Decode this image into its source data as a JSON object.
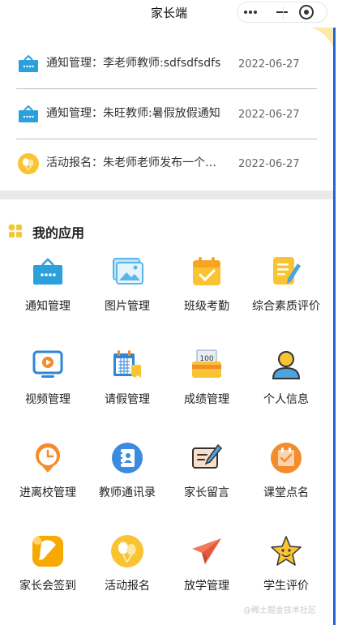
{
  "navbar": {
    "title": "家长端",
    "more_icon": "more-dots-icon",
    "minimize_icon": "minimize-icon",
    "close_icon": "target-close-icon"
  },
  "notices": [
    {
      "icon": "notice-bag-icon",
      "text": "通知管理：李老师教师:sdfsdfsdfs",
      "date": "2022-06-27"
    },
    {
      "icon": "notice-bag-icon",
      "text": "通知管理：朱旺教师:暑假放假通知",
      "date": "2022-06-27"
    },
    {
      "icon": "balloon-icon",
      "text": "活动报名：朱老师老师发布一个活动",
      "date": "2022-06-27"
    }
  ],
  "apps_section": {
    "title": "我的应用",
    "icon": "apps-grid-icon",
    "items": [
      {
        "label": "通知管理",
        "icon": "notice-bag-icon"
      },
      {
        "label": "图片管理",
        "icon": "picture-icon"
      },
      {
        "label": "班级考勤",
        "icon": "calendar-check-icon"
      },
      {
        "label": "综合素质评价",
        "icon": "note-pencil-icon"
      },
      {
        "label": "视频管理",
        "icon": "video-play-icon"
      },
      {
        "label": "请假管理",
        "icon": "leave-calendar-icon"
      },
      {
        "label": "成绩管理",
        "icon": "score-card-icon"
      },
      {
        "label": "个人信息",
        "icon": "person-icon"
      },
      {
        "label": "进离校管理",
        "icon": "clock-pin-icon"
      },
      {
        "label": "教师通讯录",
        "icon": "contact-book-icon"
      },
      {
        "label": "家长留言",
        "icon": "message-pen-icon"
      },
      {
        "label": "课堂点名",
        "icon": "rollcall-icon"
      },
      {
        "label": "家长会签到",
        "icon": "signin-pen-icon"
      },
      {
        "label": "活动报名",
        "icon": "balloon-icon"
      },
      {
        "label": "放学管理",
        "icon": "paper-plane-icon"
      },
      {
        "label": "学生评价",
        "icon": "star-face-icon"
      }
    ]
  },
  "watermark": "@稀土掘金技术社区",
  "colors": {
    "primary_blue": "#2aa1dd",
    "accent_yellow": "#f9c332",
    "accent_orange": "#f48b2c",
    "divider": "#e9e9e9"
  }
}
